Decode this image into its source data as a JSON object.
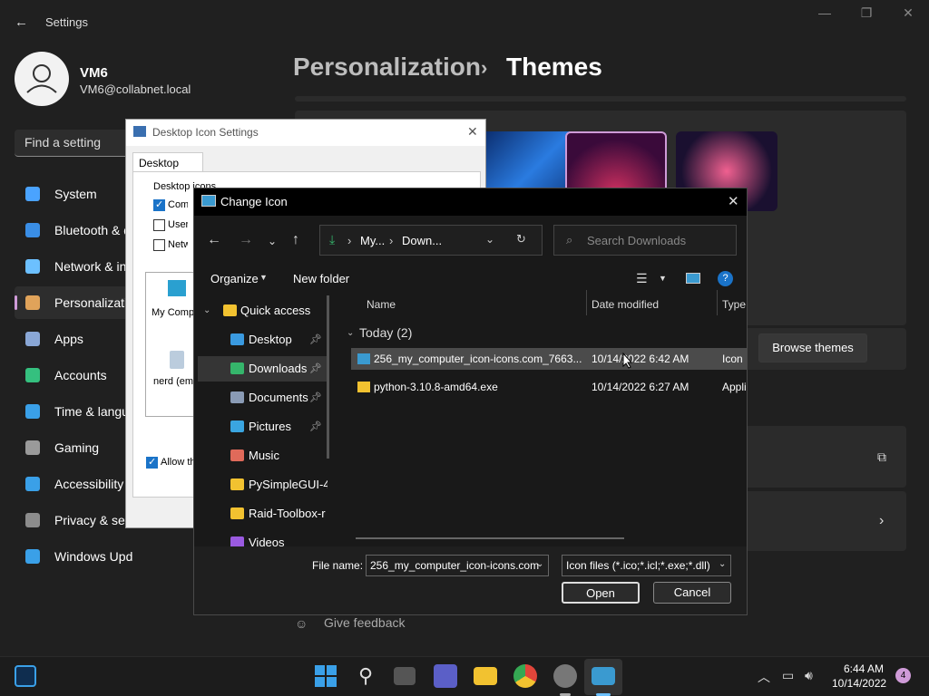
{
  "settings": {
    "title": "Settings",
    "user_name": "VM6",
    "user_email": "VM6@collabnet.local",
    "search_placeholder": "Find a setting",
    "nav": [
      {
        "label": "System",
        "color": "#4aa3ff"
      },
      {
        "label": "Bluetooth & devices",
        "color": "#3a8ee6"
      },
      {
        "label": "Network & internet",
        "color": "#6cc0ff"
      },
      {
        "label": "Personalization",
        "color": "#e0a35a"
      },
      {
        "label": "Apps",
        "color": "#8aa7d6"
      },
      {
        "label": "Accounts",
        "color": "#35c07f"
      },
      {
        "label": "Time & language",
        "color": "#3aa0e8"
      },
      {
        "label": "Gaming",
        "color": "#9a9a9a"
      },
      {
        "label": "Accessibility",
        "color": "#3aa0e8"
      },
      {
        "label": "Privacy & security",
        "color": "#8c8c8c"
      },
      {
        "label": "Windows Update",
        "color": "#3aa0e8"
      }
    ],
    "breadcrumb_parent": "Personalization",
    "breadcrumb_sep": "›",
    "breadcrumb_current": "Themes",
    "browse_themes": "Browse themes",
    "give_feedback": "Give feedback"
  },
  "desktop_icon_settings": {
    "title": "Desktop Icon Settings",
    "tab": "Desktop Icons",
    "group_label": "Desktop icons",
    "checkboxes": [
      {
        "label": "Computer",
        "checked": true
      },
      {
        "label": "User's Files",
        "checked": false
      },
      {
        "label": "Network",
        "checked": false
      }
    ],
    "icons": [
      "My Computer",
      "nerd (empty)"
    ],
    "allow_themes": "Allow themes to change desktop icons"
  },
  "change_icon": {
    "title": "Change Icon",
    "path": [
      "My...",
      "Down..."
    ],
    "search_placeholder": "Search Downloads",
    "organize": "Organize",
    "new_folder": "New folder",
    "tree": [
      {
        "label": "Quick access",
        "pinned": false,
        "color": "#f2c230"
      },
      {
        "label": "Desktop",
        "pinned": true,
        "color": "#3a9ae0"
      },
      {
        "label": "Downloads",
        "pinned": true,
        "color": "#35b56b"
      },
      {
        "label": "Documents",
        "pinned": true,
        "color": "#8a9bb5"
      },
      {
        "label": "Pictures",
        "pinned": true,
        "color": "#3aa5e0"
      },
      {
        "label": "Music",
        "pinned": false,
        "color": "#e06a5a"
      },
      {
        "label": "PySimpleGUI-4",
        "pinned": false,
        "color": "#f2c230"
      },
      {
        "label": "Raid-Toolbox-r",
        "pinned": false,
        "color": "#f2c230"
      },
      {
        "label": "Videos",
        "pinned": false,
        "color": "#9a5ae0"
      }
    ],
    "columns": {
      "name": "Name",
      "date": "Date modified",
      "type": "Type"
    },
    "group": "Today (2)",
    "files": [
      {
        "name": "256_my_computer_icon-icons.com_7663...",
        "date": "10/14/2022 6:42 AM",
        "type": "Icon"
      },
      {
        "name": "python-3.10.8-amd64.exe",
        "date": "10/14/2022 6:27 AM",
        "type": "Appli"
      }
    ],
    "file_name_label": "File name:",
    "file_name_value": "256_my_computer_icon-icons.com",
    "filter": "Icon files (*.ico;*.icl;*.exe;*.dll)",
    "open": "Open",
    "cancel": "Cancel"
  },
  "taskbar": {
    "time": "6:44 AM",
    "date": "10/14/2022",
    "notifications": "4"
  }
}
